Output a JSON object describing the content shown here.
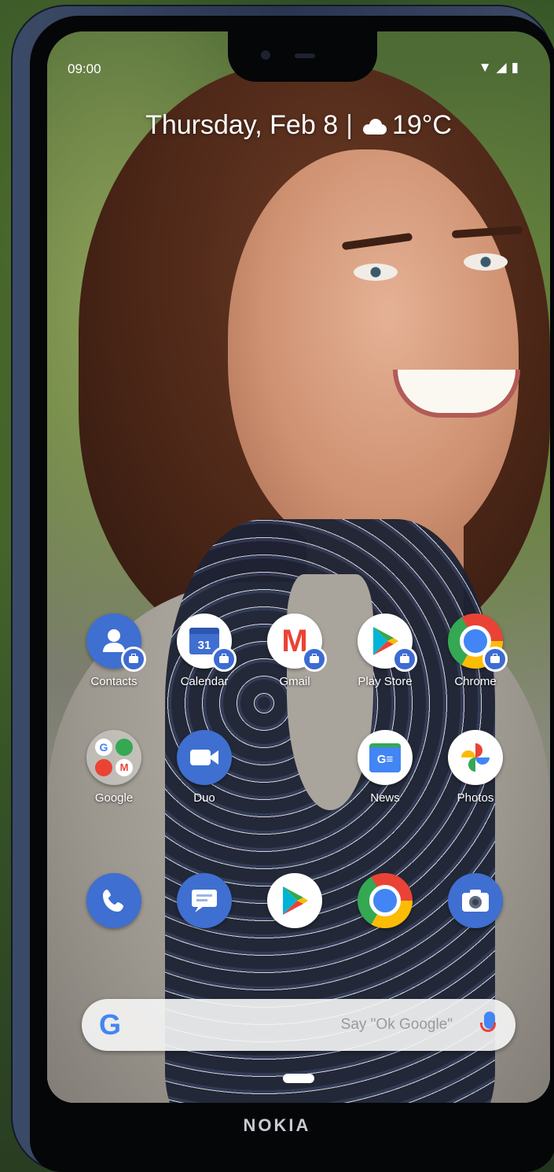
{
  "status_bar": {
    "time": "09:00",
    "icons": "▼◢▮"
  },
  "glance": {
    "date": "Thursday, Feb 8",
    "separator": "|",
    "temperature": "19°C"
  },
  "apps_row1": [
    {
      "label": "Contacts"
    },
    {
      "label": "Calendar",
      "icon_text": "31"
    },
    {
      "label": "Gmail",
      "icon_text": "M"
    },
    {
      "label": "Play Store"
    },
    {
      "label": "Chrome"
    }
  ],
  "apps_row2": [
    {
      "label": "Google"
    },
    {
      "label": "Duo"
    },
    {
      "label": "News",
      "icon_text": "G≡"
    },
    {
      "label": "Photos"
    }
  ],
  "search": {
    "g_letter": "G",
    "hint": "Say \"Ok Google\""
  },
  "brand": "NOKIA",
  "colors": {
    "google_blue": "#4285f4",
    "google_red": "#ea4335",
    "google_yellow": "#fbbc05",
    "google_green": "#34a853",
    "badge_blue": "#3d6bd1"
  }
}
